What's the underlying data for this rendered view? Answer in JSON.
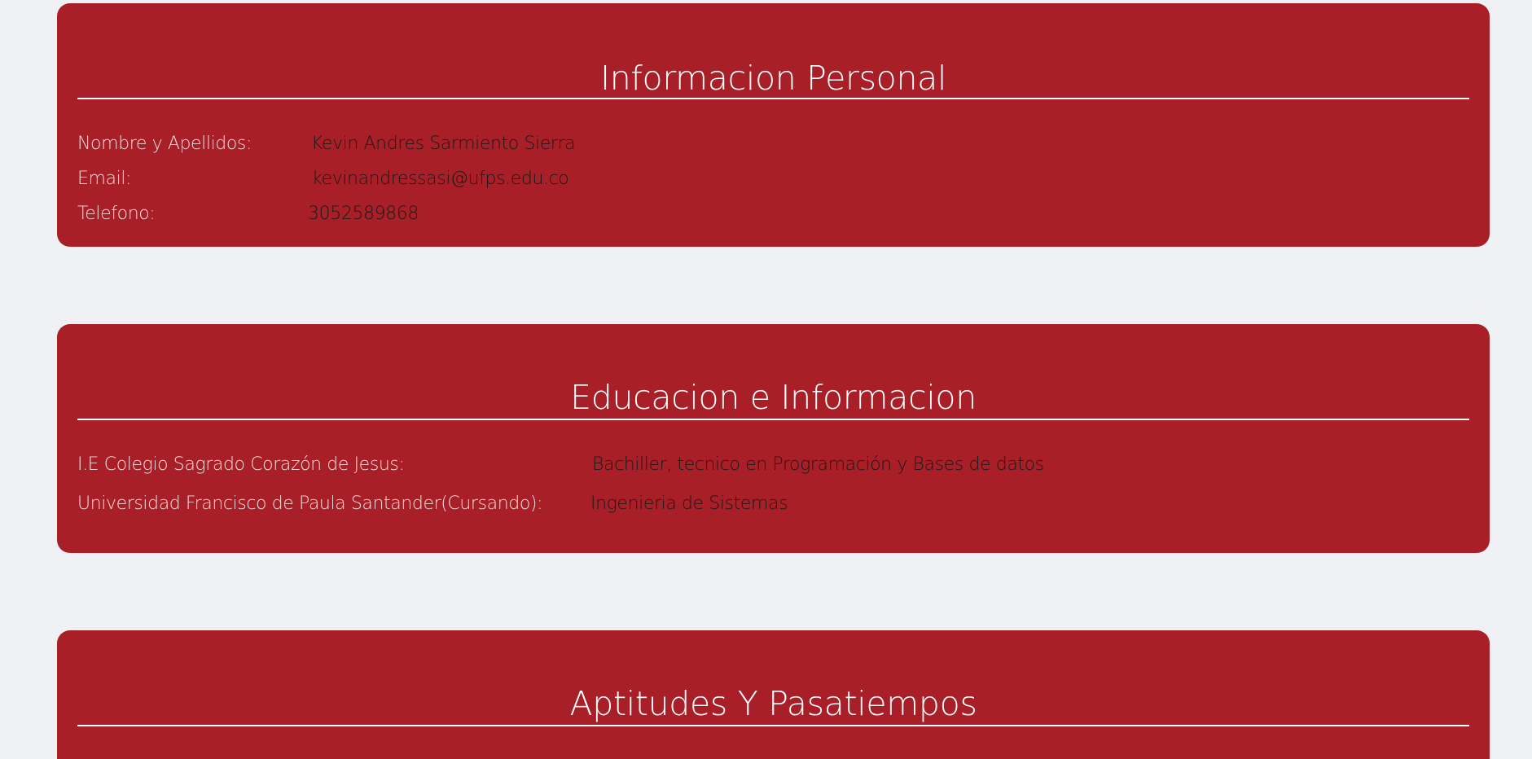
{
  "personal": {
    "title": "Informacion Personal",
    "rows": [
      {
        "label": "Nombre y Apellidos:",
        "value": "Kevin Andres Sarmiento Sierra"
      },
      {
        "label": "Email:",
        "value": "kevinandressasi@ufps.edu.co"
      },
      {
        "label": "Telefono:",
        "value": "3052589868"
      }
    ]
  },
  "education": {
    "title": "Educacion e Informacion",
    "rows": [
      {
        "label": "I.E Colegio Sagrado Corazón de Jesus:",
        "value": "Bachiller, tecnico en Programación y Bases de datos"
      },
      {
        "label": "Universidad Francisco de Paula Santander(Cursando):",
        "value": "Ingenieria de Sistemas"
      }
    ]
  },
  "aptitudes": {
    "title": "Aptitudes Y Pasatiempos"
  },
  "colors": {
    "card_background": "#a81f28",
    "page_background": "#f0f1f5",
    "title_text": "#ffffff",
    "value_text": "#1a1a1a"
  }
}
